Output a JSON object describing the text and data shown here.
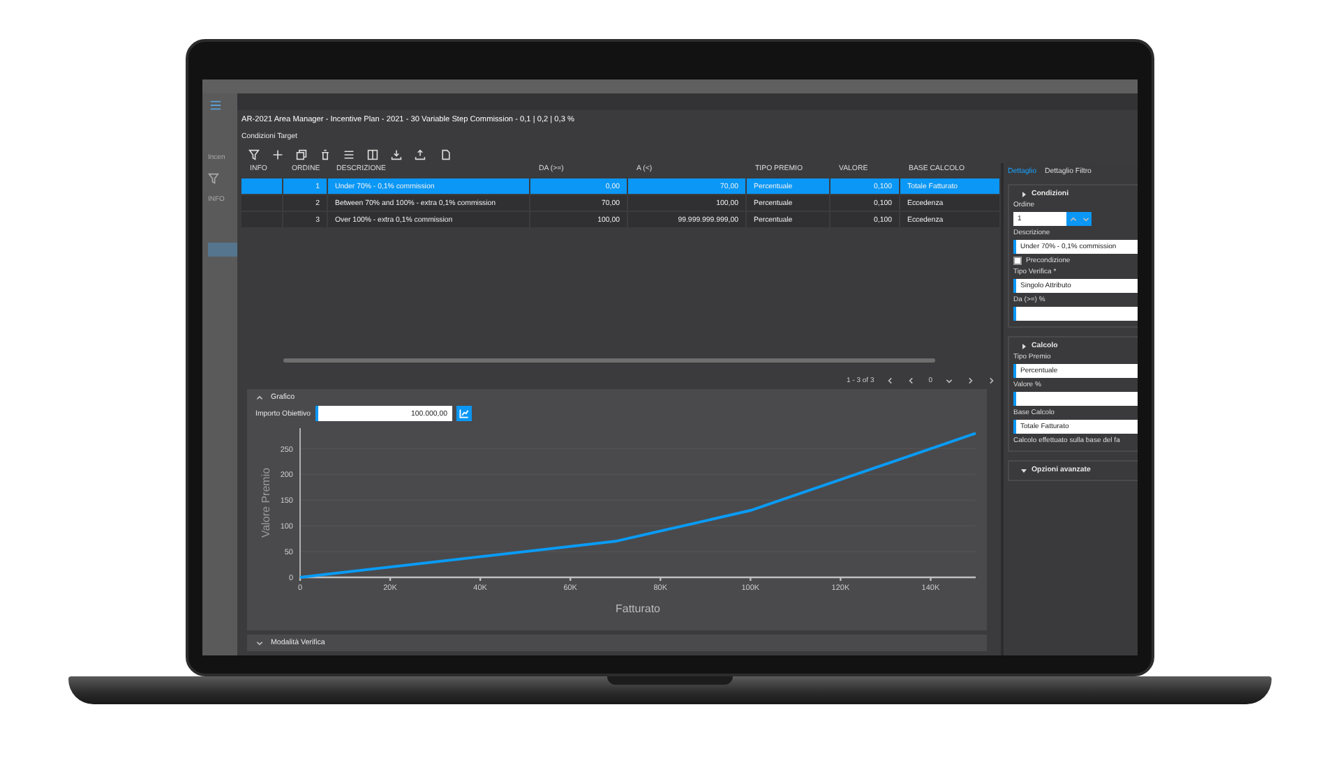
{
  "background_app": {
    "label": "Incen",
    "column": "INFO"
  },
  "dialog": {
    "title": "AR-2021 Area Manager - Incentive Plan - 2021 - 30 Variable Step Commission - 0,1 | 0,2 | 0,3 %",
    "subtitle": "Condizioni Target"
  },
  "table": {
    "columns": [
      "INFO",
      "ORDINE",
      "DESCRIZIONE",
      "DA (>=)",
      "A (<)",
      "TIPO PREMIO",
      "VALORE",
      "BASE CALCOLO"
    ],
    "rows": [
      {
        "selected": true,
        "cells": [
          "",
          "1",
          "Under 70% - 0,1% commission",
          "0,00",
          "70,00",
          "Percentuale",
          "0,100",
          "Totale Fatturato"
        ]
      },
      {
        "selected": false,
        "cells": [
          "",
          "2",
          "Between 70% and 100% - extra 0,1% commission",
          "70,00",
          "100,00",
          "Percentuale",
          "0,100",
          "Eccedenza"
        ]
      },
      {
        "selected": false,
        "cells": [
          "",
          "3",
          "Over 100% - extra 0,1% commission",
          "100,00",
          "99.999.999.999,00",
          "Percentuale",
          "0,100",
          "Eccedenza"
        ]
      }
    ]
  },
  "pager": {
    "range": "1 - 3 of 3",
    "page": "0"
  },
  "chart_panel": {
    "title": "Grafico",
    "expanded": true,
    "target_label": "Importo Obiettivo",
    "target_value": "100.000,00",
    "chart_data": {
      "type": "line",
      "xlabel": "Fatturato",
      "ylabel": "Valore Premio",
      "x": [
        0,
        70000,
        100000,
        150000
      ],
      "series": [
        {
          "color": "#0a9bf5",
          "values": [
            0,
            70,
            130,
            280
          ]
        }
      ],
      "grid": true,
      "xlim": [
        0,
        150000
      ],
      "ylim": [
        0,
        290
      ],
      "xticks": [
        {
          "value": 0,
          "label": "0"
        },
        {
          "value": 20000,
          "label": "20K"
        },
        {
          "value": 40000,
          "label": "40K"
        },
        {
          "value": 60000,
          "label": "60K"
        },
        {
          "value": 80000,
          "label": "80K"
        },
        {
          "value": 100000,
          "label": "100K"
        },
        {
          "value": 120000,
          "label": "120K"
        },
        {
          "value": 140000,
          "label": "140K"
        }
      ],
      "yticks": [
        0,
        50,
        100,
        150,
        200,
        250
      ]
    }
  },
  "verification_panel": {
    "title": "Modalità Verifica",
    "expanded": false
  },
  "detail": {
    "tabs": [
      {
        "label": "Dettaglio",
        "selected": true
      },
      {
        "label": "Dettaglio Filtro",
        "selected": false
      }
    ],
    "sections": [
      {
        "title": "Condizioni",
        "expanded": true,
        "fields": [
          {
            "kind": "spinner",
            "label": "Ordine",
            "value": "1"
          },
          {
            "kind": "text",
            "label": "Descrizione",
            "value": "Under 70% - 0,1% commission"
          },
          {
            "kind": "checkbox",
            "label": "Precondizione",
            "checked": false
          },
          {
            "kind": "text",
            "label": "Tipo Verifica *",
            "value": "Singolo Attributo"
          },
          {
            "kind": "text",
            "label": "Da (>=) %"
          }
        ]
      },
      {
        "title": "Calcolo",
        "expanded": true,
        "fields": [
          {
            "kind": "text",
            "label": "Tipo Premio",
            "value": "Percentuale"
          },
          {
            "kind": "text",
            "label": "Valore %"
          },
          {
            "kind": "text",
            "label": "Base Calcolo",
            "value": "Totale Fatturato"
          },
          {
            "kind": "note",
            "label": "Calcolo effettuato sulla base del fa"
          }
        ]
      },
      {
        "title": "Opzioni avanzate",
        "expanded": false
      }
    ]
  }
}
